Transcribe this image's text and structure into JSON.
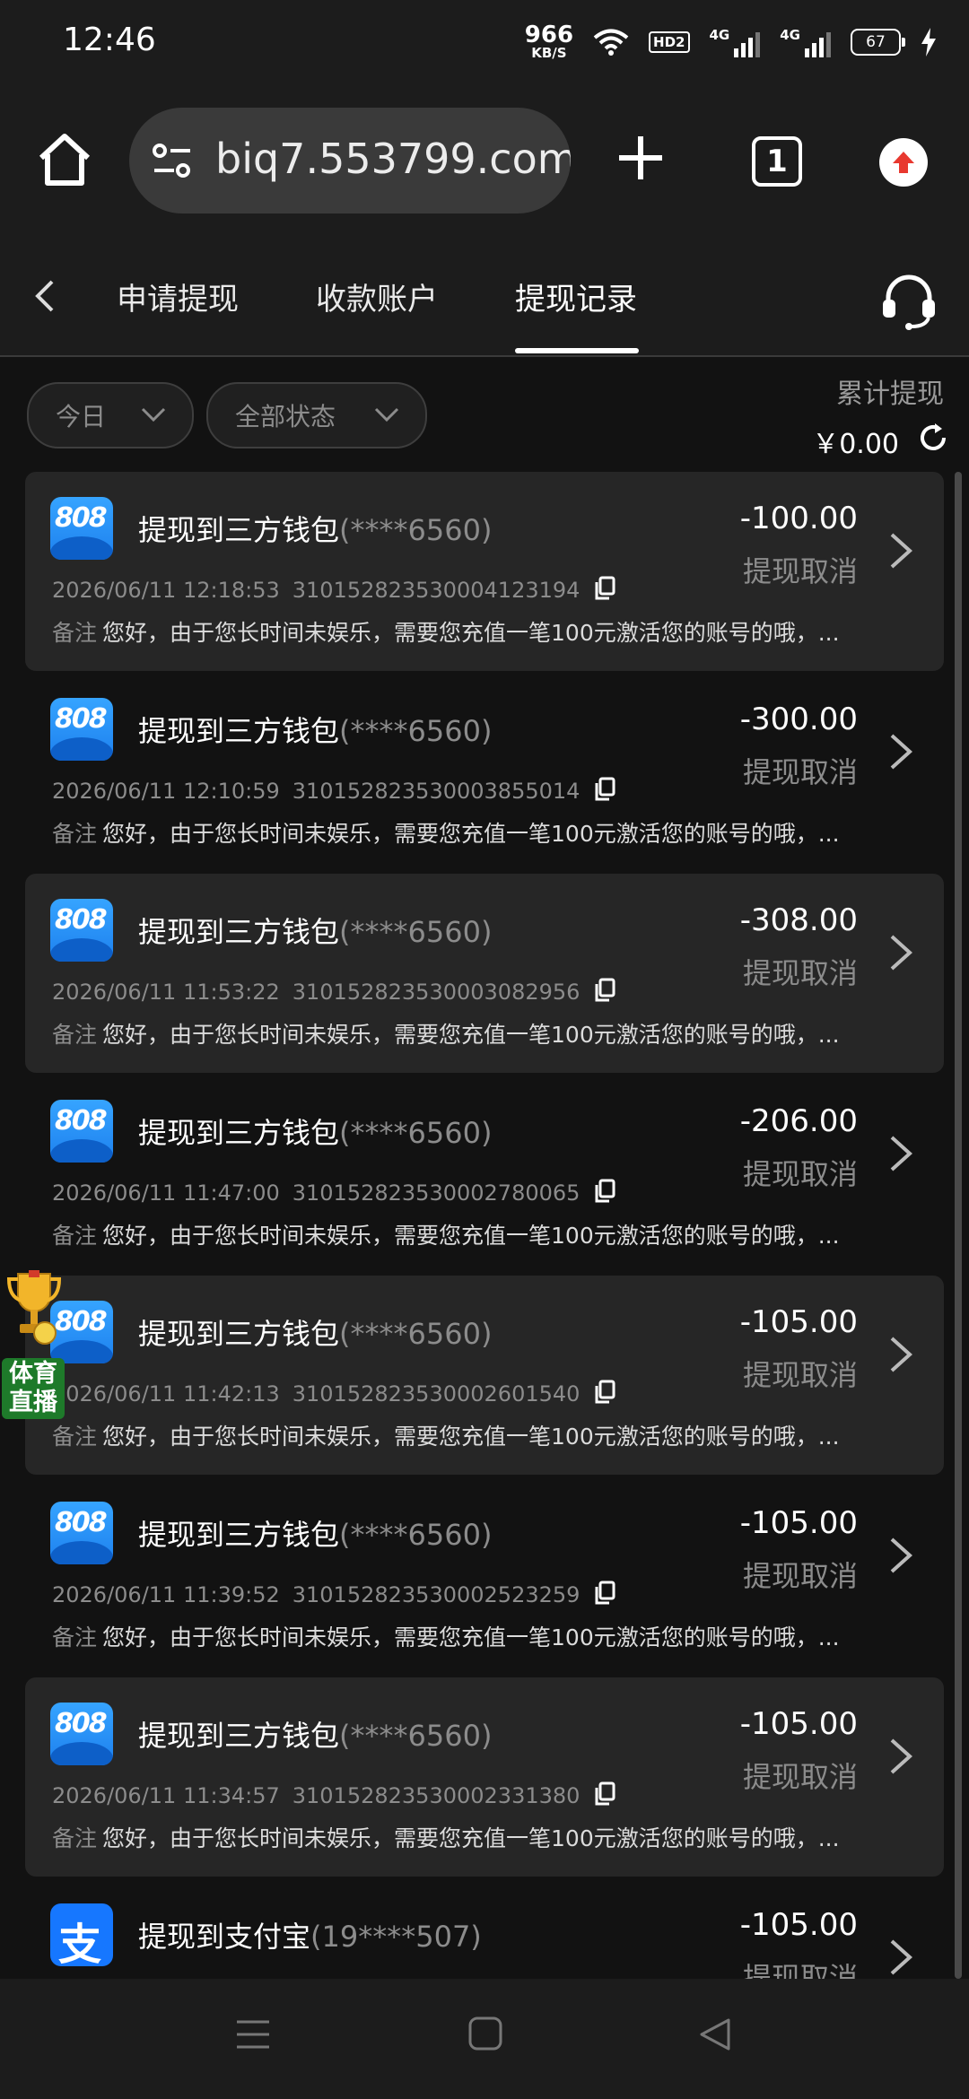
{
  "status_bar": {
    "time": "12:46",
    "net_speed_value": "966",
    "net_speed_unit": "KB/S",
    "hd_badge": "HD2",
    "sim1": "4G",
    "sim2": "4G",
    "battery": "67"
  },
  "browser": {
    "url": "biq7.553799.com",
    "tab_count": "1"
  },
  "nav": {
    "tabs": [
      "申请提现",
      "收款账户",
      "提现记录"
    ],
    "active_tab": "提现记录"
  },
  "filters": {
    "date": "今日",
    "status": "全部状态"
  },
  "summary": {
    "label": "累计提现",
    "value": "￥0.00"
  },
  "records": [
    {
      "title": "提现到三方钱包",
      "account": "(****6560)",
      "amount": "-100.00",
      "status": "提现取消",
      "datetime": "2026/06/11 12:18:53",
      "order_no": "310152823530004123194",
      "note_label": "备注",
      "note": "您好，由于您长时间未娱乐，需要您充值一笔100元激活您的账号的哦，...",
      "logo": "808"
    },
    {
      "title": "提现到三方钱包",
      "account": "(****6560)",
      "amount": "-300.00",
      "status": "提现取消",
      "datetime": "2026/06/11 12:10:59",
      "order_no": "310152823530003855014",
      "note_label": "备注",
      "note": "您好，由于您长时间未娱乐，需要您充值一笔100元激活您的账号的哦，...",
      "logo": "808"
    },
    {
      "title": "提现到三方钱包",
      "account": "(****6560)",
      "amount": "-308.00",
      "status": "提现取消",
      "datetime": "2026/06/11 11:53:22",
      "order_no": "310152823530003082956",
      "note_label": "备注",
      "note": "您好，由于您长时间未娱乐，需要您充值一笔100元激活您的账号的哦，...",
      "logo": "808"
    },
    {
      "title": "提现到三方钱包",
      "account": "(****6560)",
      "amount": "-206.00",
      "status": "提现取消",
      "datetime": "2026/06/11 11:47:00",
      "order_no": "310152823530002780065",
      "note_label": "备注",
      "note": "您好，由于您长时间未娱乐，需要您充值一笔100元激活您的账号的哦，...",
      "logo": "808"
    },
    {
      "title": "提现到三方钱包",
      "account": "(****6560)",
      "amount": "-105.00",
      "status": "提现取消",
      "datetime": "2026/06/11 11:42:13",
      "order_no": "310152823530002601540",
      "note_label": "备注",
      "note": "您好，由于您长时间未娱乐，需要您充值一笔100元激活您的账号的哦，...",
      "logo": "808"
    },
    {
      "title": "提现到三方钱包",
      "account": "(****6560)",
      "amount": "-105.00",
      "status": "提现取消",
      "datetime": "2026/06/11 11:39:52",
      "order_no": "310152823530002523259",
      "note_label": "备注",
      "note": "您好，由于您长时间未娱乐，需要您充值一笔100元激活您的账号的哦，...",
      "logo": "808"
    },
    {
      "title": "提现到三方钱包",
      "account": "(****6560)",
      "amount": "-105.00",
      "status": "提现取消",
      "datetime": "2026/06/11 11:34:57",
      "order_no": "310152823530002331380",
      "note_label": "备注",
      "note": "您好，由于您长时间未娱乐，需要您充值一笔100元激活您的账号的哦，...",
      "logo": "808"
    },
    {
      "title": "提现到支付宝",
      "account": "(19****507)",
      "amount": "-105.00",
      "status": "提现取消",
      "logo": "alipay"
    }
  ],
  "floating_badge": {
    "label": "体育直播"
  },
  "colors": {
    "background": "#121212",
    "card_alt": "#262626",
    "muted_text": "#8c8c8c",
    "brand_blue": "#1677ff"
  },
  "icons": {
    "home": "home-icon",
    "site_settings": "tune-icon",
    "new_tab": "plus-icon",
    "tab_switcher": "tabs-icon",
    "update": "upload-arrow-icon",
    "back": "chevron-left-icon",
    "support": "headset-icon",
    "dropdown": "chevron-down-icon",
    "refresh": "refresh-icon",
    "row": "chevron-right-icon",
    "copy": "copy-icon"
  }
}
